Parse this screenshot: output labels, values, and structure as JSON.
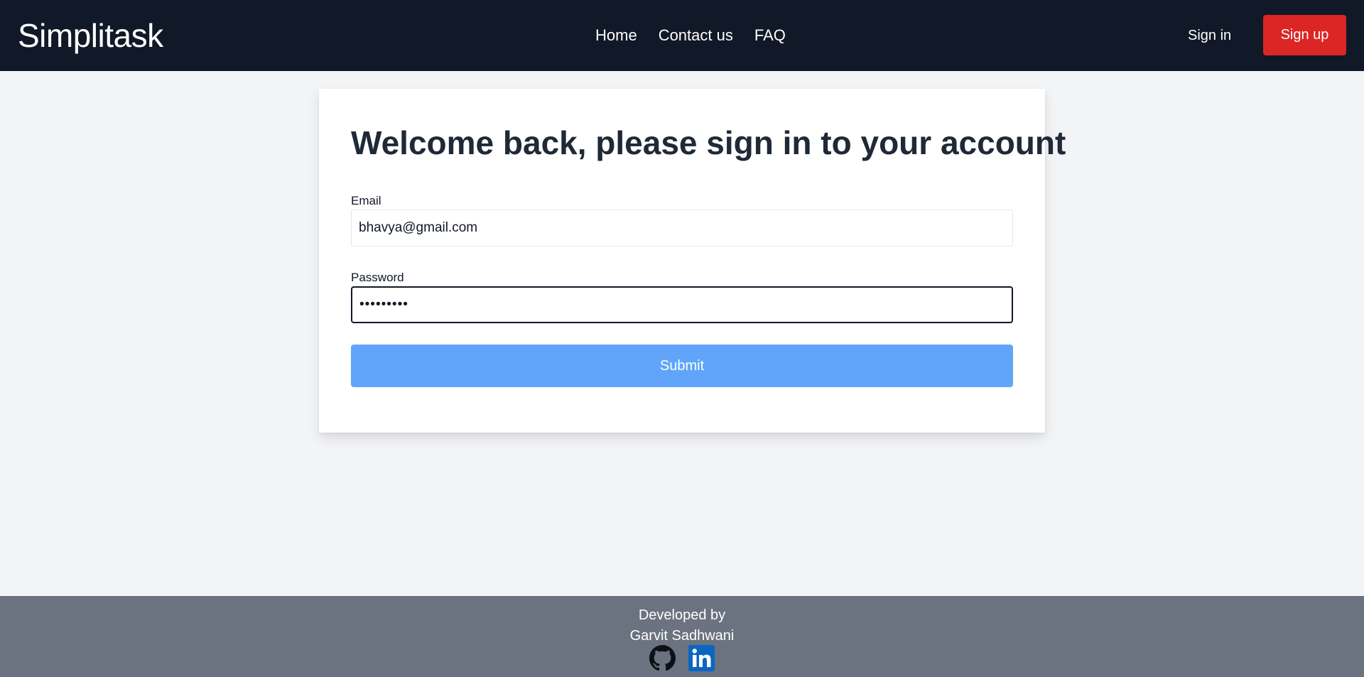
{
  "navbar": {
    "brand": "Simplitask",
    "links": [
      "Home",
      "Contact us",
      "FAQ"
    ],
    "sign_in": "Sign in",
    "sign_up": "Sign up",
    "background": "#111827",
    "signup_color": "#dc2626"
  },
  "form": {
    "title": "Welcome back, please sign in to your account",
    "email_label": "Email",
    "email_value": "bhavya@gmail.com",
    "password_label": "Password",
    "password_value": "•••••••••",
    "submit_label": "Submit",
    "submit_color": "#60a5fa"
  },
  "footer": {
    "line1": "Developed by",
    "line2": "Garvit Sadhwani",
    "icons": [
      "github-icon",
      "linkedin-icon"
    ],
    "background": "#6b7280"
  }
}
